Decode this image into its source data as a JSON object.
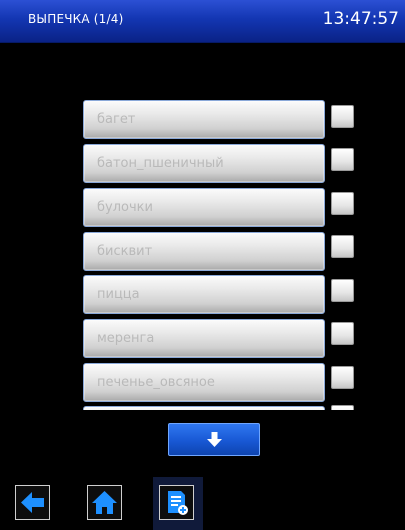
{
  "header": {
    "title": "ВЫПЕЧКА (1/4)",
    "time": "13:47:57"
  },
  "items": [
    {
      "label": "багет"
    },
    {
      "label": "батон_пшеничный"
    },
    {
      "label": "булочки"
    },
    {
      "label": "бисквит"
    },
    {
      "label": "пицца"
    },
    {
      "label": "меренга"
    },
    {
      "label": "печенье_овсяное"
    },
    {
      "label": ""
    }
  ],
  "icons": {
    "scroll": "arrow-down-icon",
    "back": "arrow-left-icon",
    "home": "home-icon",
    "add": "document-add-icon"
  },
  "colors": {
    "header": "#1336b2",
    "accent": "#1a5ad6",
    "item_text": "#b9b9b9",
    "icon_blue": "#1e90ff"
  }
}
